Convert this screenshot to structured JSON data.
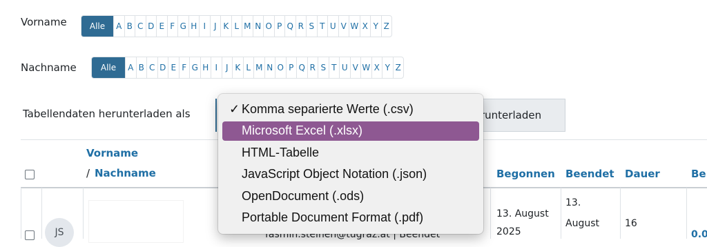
{
  "filters": {
    "firstname_label": "Vorname",
    "lastname_label": "Nachname",
    "all_label": "Alle",
    "letters": [
      "A",
      "B",
      "C",
      "D",
      "E",
      "F",
      "G",
      "H",
      "I",
      "J",
      "K",
      "L",
      "M",
      "N",
      "O",
      "P",
      "Q",
      "R",
      "S",
      "T",
      "U",
      "V",
      "W",
      "X",
      "Y",
      "Z"
    ]
  },
  "download": {
    "label": "Tabellendaten herunterladen als",
    "button_label": "runterladen"
  },
  "dropdown": {
    "selected_index": 0,
    "highlighted_index": 1,
    "options": [
      "Komma separierte Werte (.csv)",
      "Microsoft Excel (.xlsx)",
      "HTML-Tabelle",
      "JavaScript Object Notation (.json)",
      "OpenDocument (.ods)",
      "Portable Document Format (.pdf)"
    ],
    "check_glyph": "✓"
  },
  "table": {
    "headers": {
      "firstname": "Vorname",
      "separator": "/ ",
      "lastname": "Nachname",
      "started": "Begonnen",
      "finished": "Beendet",
      "duration": "Dauer",
      "partial": "Be"
    },
    "row": {
      "initials": "JS",
      "email_fragment": "fasmin.steinen@tugraz.at | Beendet",
      "started_line1": "13. August",
      "started_line2": "2025",
      "finished_line1": "13.",
      "finished_line2": "August",
      "duration": "16",
      "score_fragment": "0.0"
    }
  },
  "colors": {
    "accent": "#2f6b93",
    "link": "#1f6fa5",
    "highlight": "#8e5892"
  }
}
